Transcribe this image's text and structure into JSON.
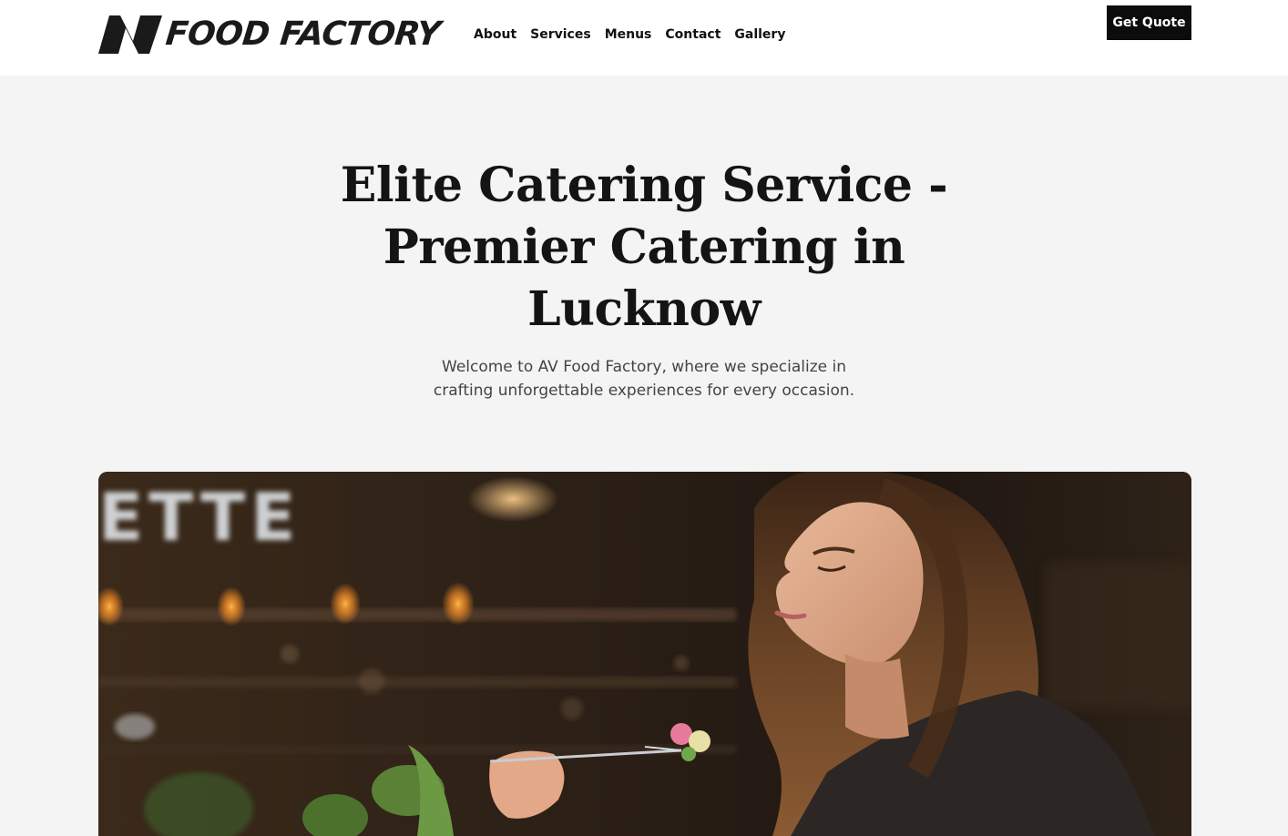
{
  "brand": {
    "logo_text": "FOOD FACTORY"
  },
  "nav": {
    "items": [
      "About",
      "Services",
      "Menus",
      "Contact",
      "Gallery"
    ]
  },
  "header": {
    "cta_label": "Get Quote"
  },
  "hero": {
    "title": "Elite Catering Service - Premier Catering in Lucknow",
    "subtitle": "Welcome to AV Food Factory, where we specialize in crafting unforgettable experiences for every occasion.",
    "image_sign_text": "ETTE"
  },
  "colors": {
    "header_bg": "#ffffff",
    "page_bg": "#f4f4f4",
    "button_bg": "#0c0c0c",
    "text_dark": "#141414",
    "text_muted": "#444444"
  }
}
